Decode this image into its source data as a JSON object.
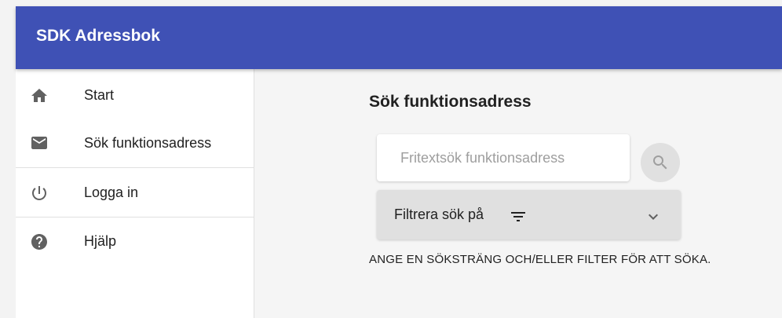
{
  "app": {
    "title": "SDK Adressbok"
  },
  "sidebar": {
    "items": [
      {
        "icon": "home-icon",
        "label": "Start"
      },
      {
        "icon": "mail-icon",
        "label": "Sök funktionsadress"
      },
      {
        "icon": "power-icon",
        "label": "Logga in"
      },
      {
        "icon": "help-icon",
        "label": "Hjälp"
      }
    ]
  },
  "main": {
    "title": "Sök funktionsadress",
    "search": {
      "placeholder": "Fritextsök funktionsadress",
      "value": ""
    },
    "filter": {
      "label": "Filtrera sök på"
    },
    "hint": "ANGE EN SÖKSTRÄNG OCH/ELLER FILTER FÖR ATT SÖKA."
  },
  "colors": {
    "appbar": "#3f51b5",
    "icon": "#616161"
  }
}
